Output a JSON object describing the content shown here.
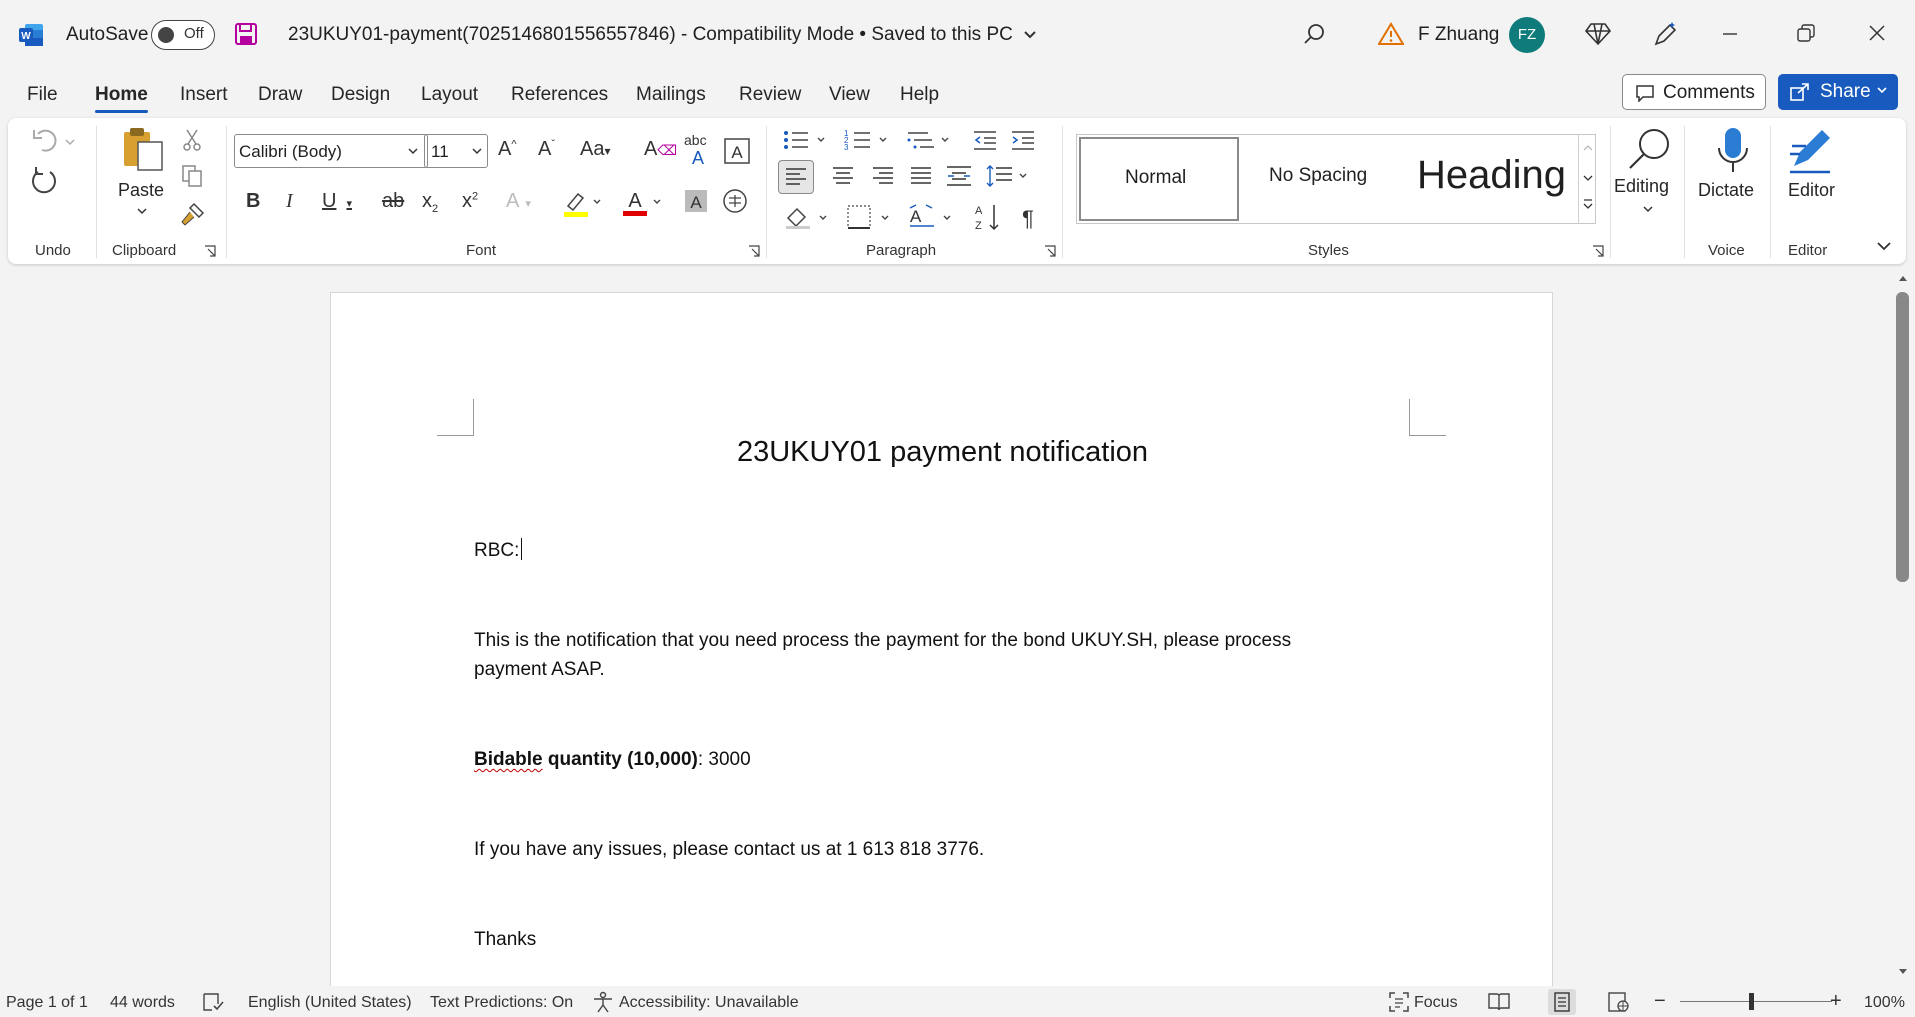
{
  "titlebar": {
    "autosave_label": "AutoSave",
    "autosave_state": "Off",
    "document_title": "23UKUY01-payment(7025146801556557846)  -  Compatibility Mode • Saved to this PC",
    "user_name": "F Zhuang",
    "user_initials": "FZ"
  },
  "tabs": [
    "File",
    "Home",
    "Insert",
    "Draw",
    "Design",
    "Layout",
    "References",
    "Mailings",
    "Review",
    "View",
    "Help"
  ],
  "active_tab": "Home",
  "actions": {
    "comments": "Comments",
    "share": "Share"
  },
  "ribbon": {
    "groups": {
      "undo": "Undo",
      "clipboard": "Clipboard",
      "font": "Font",
      "paragraph": "Paragraph",
      "styles": "Styles",
      "voice": "Voice",
      "editor": "Editor"
    },
    "paste_label": "Paste",
    "font_name": "Calibri (Body)",
    "font_size": "11",
    "styles": [
      "Normal",
      "No Spacing",
      "Heading"
    ],
    "editing_label": "Editing",
    "dictate_label": "Dictate",
    "editor_label": "Editor",
    "colors": {
      "highlight": "#ffff00",
      "font_color": "#e00000",
      "accent": "#185abd"
    }
  },
  "document": {
    "title": "23UKUY01 payment notification",
    "salutation": "RBC:",
    "body1": "This is the notification that you need process the payment for the bond UKUY.SH, please process payment ASAP.",
    "bid_label_word1": "Bidable",
    "bid_label_rest": " quantity (10,000)",
    "bid_value": ": 3000",
    "contact": "If you have any issues, please contact us at 1 613 818 3776.",
    "closing": "Thanks"
  },
  "statusbar": {
    "page": "Page 1 of 1",
    "words": "44 words",
    "language": "English (United States)",
    "predictions": "Text Predictions: On",
    "accessibility": "Accessibility: Unavailable",
    "focus": "Focus",
    "zoom": "100%"
  }
}
